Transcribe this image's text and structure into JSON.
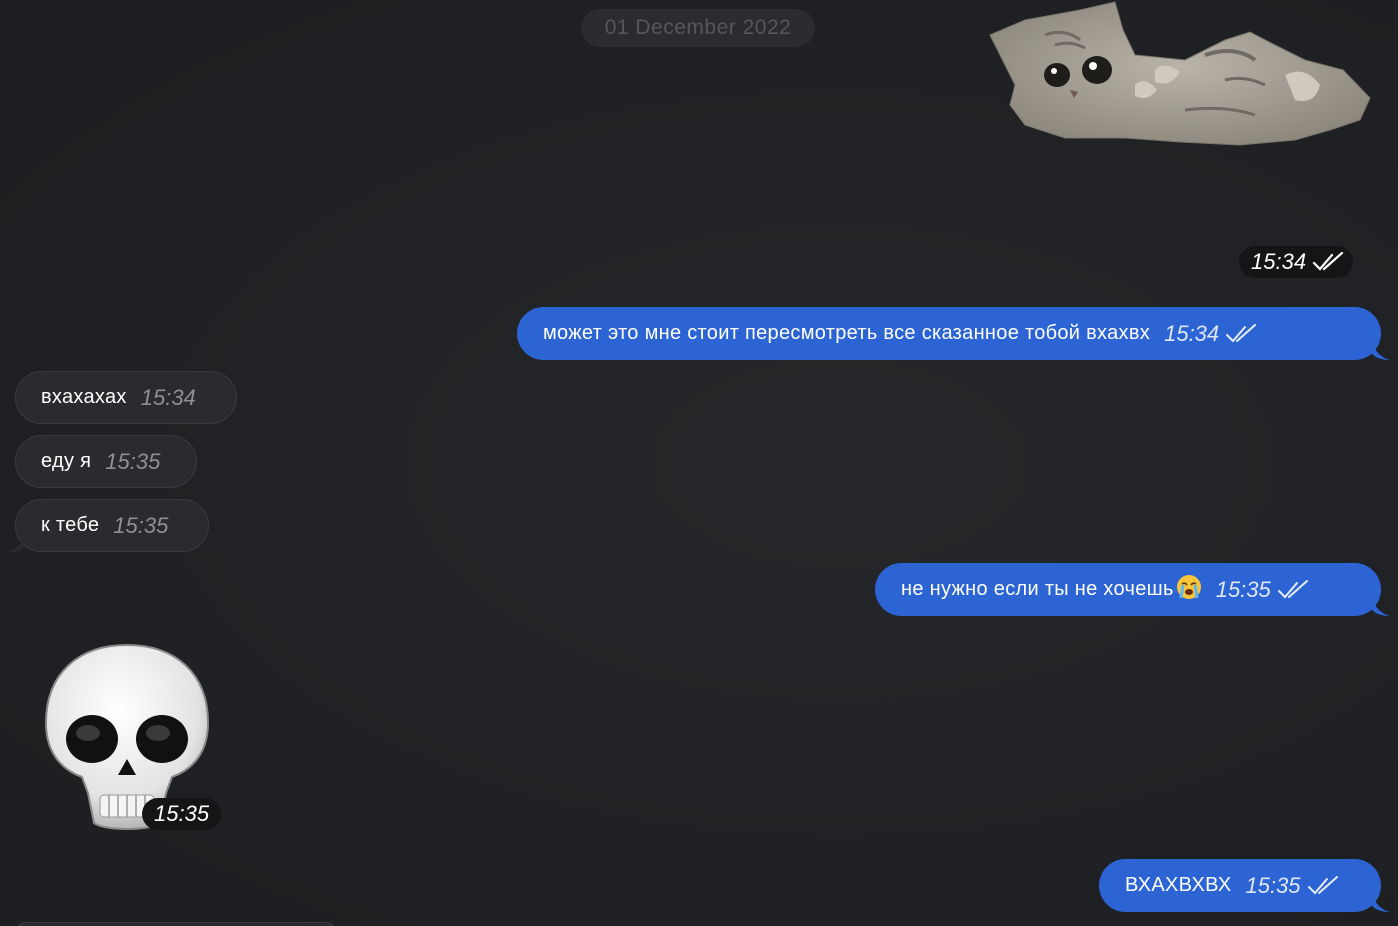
{
  "date_separator": "01 December 2022",
  "sticker_cat": {
    "icon": "kitten-sticker",
    "time": "15:34",
    "status": "read"
  },
  "messages": [
    {
      "direction": "out",
      "text": "может это мне стоит пересмотреть все сказанное тобой вхахвх",
      "time": "15:34",
      "status": "read"
    },
    {
      "direction": "in",
      "text": "вхахахах",
      "time": "15:34"
    },
    {
      "direction": "in",
      "text": "еду я",
      "time": "15:35"
    },
    {
      "direction": "in",
      "text": "к тебе",
      "time": "15:35"
    },
    {
      "direction": "out",
      "text": "не нужно если ты не хочешь",
      "emoji": "loudly-crying-face-icon",
      "time": "15:35",
      "status": "read"
    },
    {
      "direction": "out",
      "text": "ВХАХВХВХ",
      "time": "15:35",
      "status": "read"
    }
  ],
  "sticker_skull": {
    "icon": "skull-emoji",
    "time": "15:35"
  },
  "colors": {
    "background": "#202225",
    "outgoing_bubble": "#2c64d4",
    "incoming_bubble": "#2a2b2f"
  }
}
